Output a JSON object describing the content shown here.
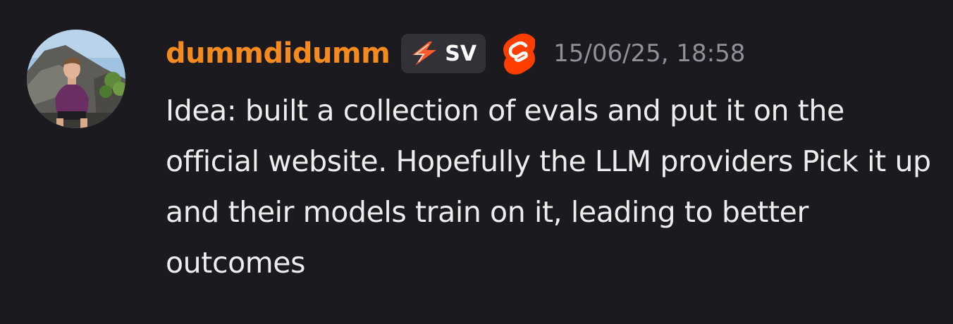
{
  "message": {
    "username": "dummdidumm",
    "username_color": "#f58a1f",
    "guild_tag": {
      "icon": "lightning-bolt-icon",
      "text": "SV"
    },
    "role_icon": "svelte-logo-icon",
    "timestamp": "15/06/25, 18:58",
    "avatar": "user-avatar-photo",
    "content": "Idea: built a collection of evals and put it on the official website. Hopefully the LLM providers Pick it up and their models train on it, leading to better outcomes"
  }
}
